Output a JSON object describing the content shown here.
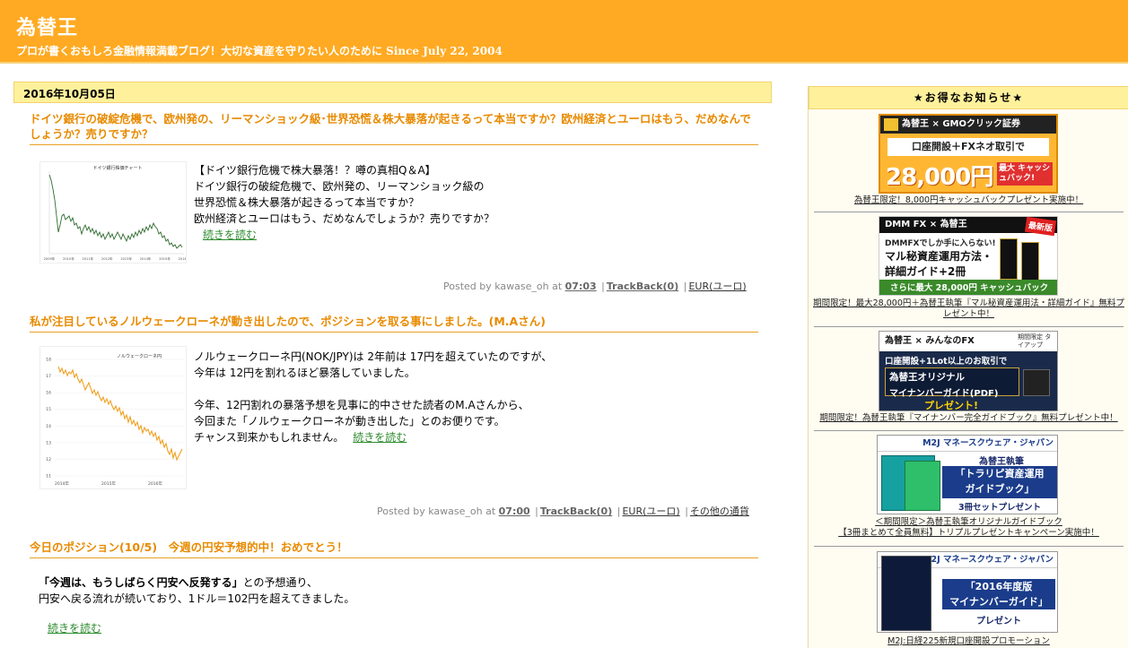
{
  "header": {
    "title": "為替王",
    "description": "プロが書くおもしろ金融情報満載ブログ！大切な資産を守りたい人のために Since July 22, 2004"
  },
  "date_header": "2016年10月05日",
  "posts": [
    {
      "title": "ドイツ銀行の破綻危機で、欧州発の、リーマンショック級･世界恐慌＆株大暴落が起きるって本当ですか？欧州経済とユーロはもう、だめなんでしょうか？売りですか？",
      "thumb_title": "ドイツ銀行株価チャート",
      "thumb_xticks": [
        "2009年",
        "2010年",
        "2011年",
        "2012年",
        "2013年",
        "2014年",
        "2015年",
        "2016年"
      ],
      "lines": [
        "【ドイツ銀行危機で株大暴落！？噂の真相Q＆A】",
        "ドイツ銀行の破綻危機で、欧州発の、リーマンショック級の",
        "世界恐慌＆株大暴落が起きるって本当ですか？",
        "欧州経済とユーロはもう、だめなんでしょうか？売りですか？"
      ],
      "more": "続きを読む",
      "meta": {
        "posted": "Posted by kawase_oh at",
        "time": "07:03",
        "trackback": "TrackBack(0)",
        "category": "EUR(ユーロ)"
      }
    },
    {
      "title": "私が注目しているノルウェークローネが動き出したので、ポジションを取る事にしました。(M.Aさん)",
      "thumb_title": "ノルウェークローネ円",
      "thumb_yticks": [
        "18",
        "17",
        "16",
        "15",
        "14",
        "13",
        "12",
        "11"
      ],
      "thumb_xticks": [
        "2014年",
        "2015年",
        "2016年"
      ],
      "lines": [
        "ノルウェークローネ円(NOK/JPY)は 2年前は 17円を超えていたのですが、",
        "今年は 12円を割れるほど暴落していました。",
        "",
        "今年、12円割れの暴落予想を見事に的中させた読者のM.Aさんから、",
        "今回また「ノルウェークローネが動き出した」とのお便りです。",
        "チャンス到来かもしれません。"
      ],
      "more": "続きを読む",
      "meta": {
        "posted": "Posted by kawase_oh at",
        "time": "07:00",
        "trackback": "TrackBack(0)",
        "category": "EUR(ユーロ)",
        "category2": "その他の通貨"
      }
    },
    {
      "title": "今日のポジション(10/5)　今週の円安予想的中！おめでとう！",
      "quote": "「今週は、もうしばらく円安へ反発する」",
      "line1_rest": "との予想通り、",
      "line2": "円安へ戻る流れが続いており、1ドル＝102円を超えてきました。",
      "more": "続きを読む"
    }
  ],
  "sidebar": {
    "heading": "★お得なお知らせ★",
    "banners": [
      {
        "brand": "為替王 × GMOクリック証券",
        "body": "口座開設＋FXネオ取引で",
        "big": "28,000円",
        "small": "最大 キャッシュバック!",
        "caption": "為替王限定！8,000円キャッシュバックプレゼント実施中！"
      },
      {
        "brand": "DMM FX × 為替王",
        "badge": "最新版",
        "body1": "DMMFXでしか手に入らない!",
        "body2": "マル秘資産運用方法・",
        "body3": "詳細ガイド+2冊",
        "body4": "さらに最大 28,000円 キャッシュバック",
        "caption1": "期間限定！最大28,000円＋為替王執筆『マル秘資産運用法・詳細ガイド』無料プ",
        "caption2": "レゼント中！"
      },
      {
        "brand": "為替王 × みんなのFX",
        "tag": "期間限定 タイアップ",
        "body1": "口座開設+1Lot以上のお取引で",
        "body2": "為替王オリジナル",
        "body3": "マイナンバーガイド(PDF)",
        "body4": "プレゼント!",
        "caption": "期間限定！為替王執筆『マイナンバー完全ガイドブック』無料プレゼント中！"
      },
      {
        "brand": "M2J マネースクウェア・ジャパン",
        "body1": "為替王執筆",
        "body2": "「トラリピ資産運用",
        "body3": "ガイドブック」",
        "body4": "3冊セットプレゼント",
        "caption1": "＜期間限定＞為替王執筆オリジナルガイドブック",
        "caption2": "【3冊まとめて全員無料】トリプルプレゼントキャンペーン実施中！"
      },
      {
        "brand": "M2J マネースクウェア・ジャパン",
        "body1": "「2016年度版",
        "body2": "マイナンバーガイド」",
        "body3": "プレゼント",
        "caption": "M2J:日経225新規口座開設プロモーション"
      }
    ]
  },
  "colors": {
    "header_bg": "#ffaa22",
    "post_title": "#e88a00",
    "date_bar": "#fff19c",
    "link_green": "#2e8b2e"
  }
}
